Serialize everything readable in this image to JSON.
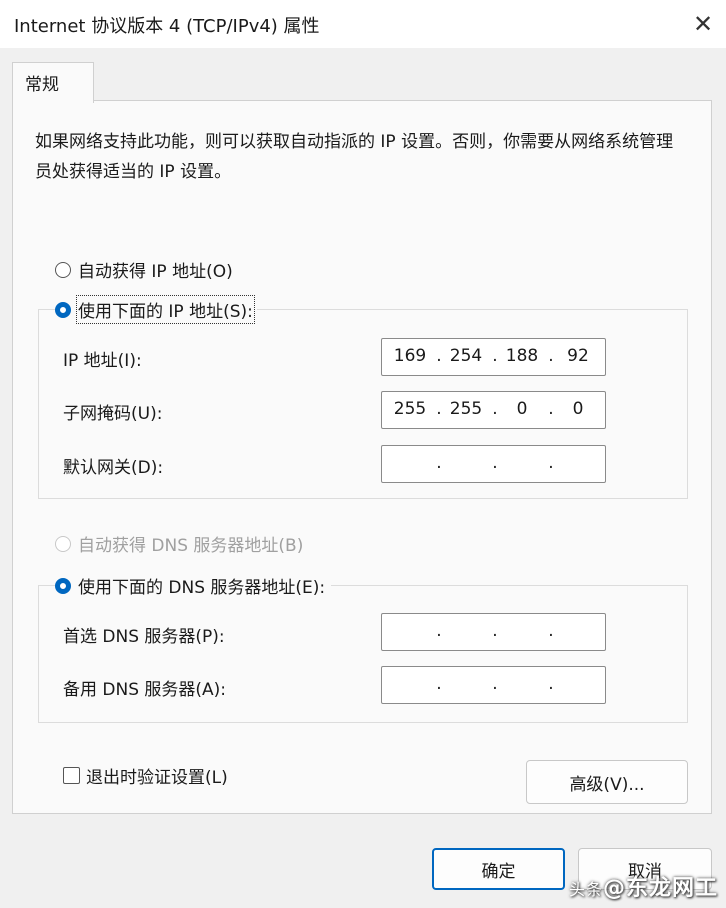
{
  "window": {
    "title": "Internet 协议版本 4 (TCP/IPv4) 属性",
    "close_glyph": "✕"
  },
  "tabs": [
    {
      "label": "常规",
      "active": true
    }
  ],
  "description": "如果网络支持此功能，则可以获取自动指派的 IP 设置。否则，你需要从网络系统管理员处获得适当的 IP 设置。",
  "ip_section": {
    "auto_label": "自动获得 IP 地址(O)",
    "manual_label": "使用下面的 IP 地址(S):",
    "selected": "manual",
    "fields": [
      {
        "label": "IP 地址(I):",
        "octets": [
          "169",
          "254",
          "188",
          "92"
        ]
      },
      {
        "label": "子网掩码(U):",
        "octets": [
          "255",
          "255",
          "0",
          "0"
        ]
      },
      {
        "label": "默认网关(D):",
        "octets": [
          "",
          "",
          "",
          ""
        ]
      }
    ]
  },
  "dns_section": {
    "auto_label": "自动获得 DNS 服务器地址(B)",
    "auto_disabled": true,
    "manual_label": "使用下面的 DNS 服务器地址(E):",
    "selected": "manual",
    "fields": [
      {
        "label": "首选 DNS 服务器(P):",
        "octets": [
          "",
          "",
          "",
          ""
        ]
      },
      {
        "label": "备用 DNS 服务器(A):",
        "octets": [
          "",
          "",
          "",
          ""
        ]
      }
    ]
  },
  "validate_checkbox": {
    "label": "退出时验证设置(L)",
    "checked": false
  },
  "buttons": {
    "advanced": "高级(V)...",
    "ok": "确定",
    "cancel": "取消"
  },
  "watermark": {
    "prefix": "头条",
    "text": "@东龙网工"
  },
  "colors": {
    "accent": "#0067c0",
    "disabled": "#a0a0a0"
  }
}
